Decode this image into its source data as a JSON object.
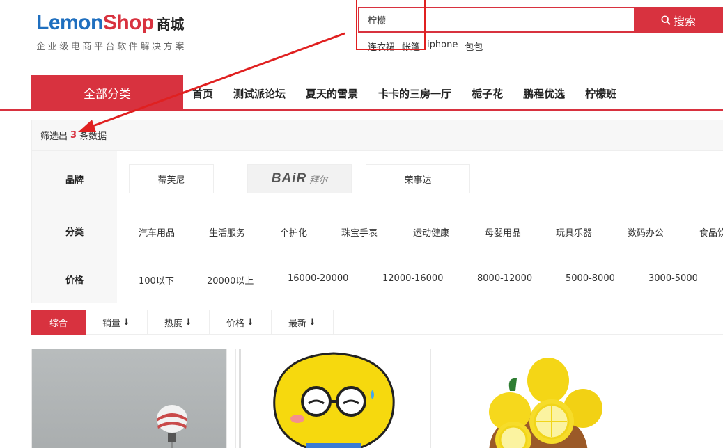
{
  "logo": {
    "part1": "Lemon",
    "part2": "Shop",
    "cn": "商城",
    "subtitle": "企业级电商平台软件解决方案"
  },
  "search": {
    "value": "柠檬",
    "button_label": "搜索"
  },
  "hot_words": [
    "连衣裙",
    "帐篷",
    "iphone",
    "包包"
  ],
  "nav": {
    "all_categories": "全部分类",
    "items": [
      "首页",
      "测试派论坛",
      "夏天的雪景",
      "卡卡的三房一厅",
      "栀子花",
      "鹏程优选",
      "柠檬班"
    ]
  },
  "filter": {
    "head_prefix": "筛选出",
    "count": "3",
    "head_suffix": "条数据",
    "brand_label": "品牌",
    "brands": [
      "蒂芙尼",
      "BAiR拜尔",
      "荣事达"
    ],
    "bair_logo_text": "BAiR",
    "bair_logo_cn": "拜尔",
    "category_label": "分类",
    "categories": [
      "汽车用品",
      "生活服务",
      "个护化",
      "珠宝手表",
      "运动健康",
      "母婴用品",
      "玩具乐器",
      "数码办公",
      "食品饮"
    ],
    "price_label": "价格",
    "prices": [
      "100以下",
      "20000以上",
      "16000-20000",
      "12000-16000",
      "8000-12000",
      "5000-8000",
      "3000-5000"
    ]
  },
  "sort": {
    "items": [
      "综合",
      "销量",
      "热度",
      "价格",
      "最新"
    ],
    "arrow": "↓",
    "active_index": 0
  },
  "products": [
    {
      "image": "hot-air-balloon-photo"
    },
    {
      "image": "lemon-cartoon-character"
    },
    {
      "image": "lemons-in-bowl-photo"
    }
  ],
  "colors": {
    "brand_red": "#d8323f",
    "logo_blue": "#1f6fbf",
    "annotation_red": "#e02020"
  }
}
